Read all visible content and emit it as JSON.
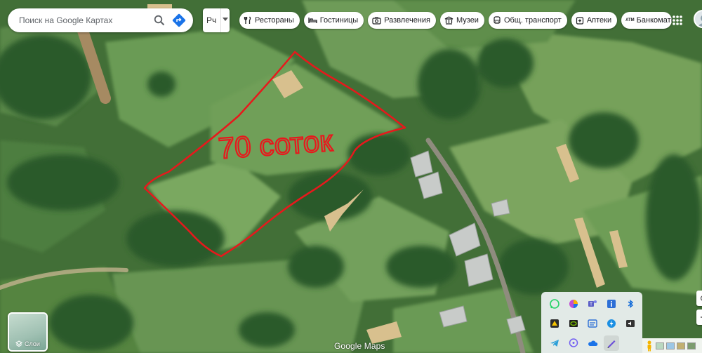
{
  "search": {
    "placeholder": "Поиск на Google Картах",
    "search_icon": "search-icon",
    "directions_icon": "directions-icon"
  },
  "language": {
    "label": "Рч"
  },
  "chips": [
    {
      "label": "Рестораны",
      "icon": "fork-knife-icon"
    },
    {
      "label": "Гостиницы",
      "icon": "bed-icon"
    },
    {
      "label": "Развлечения",
      "icon": "camera-icon"
    },
    {
      "label": "Музеи",
      "icon": "museum-icon"
    },
    {
      "label": "Общ. транспорт",
      "icon": "bus-icon"
    },
    {
      "label": "Аптеки",
      "icon": "pharmacy-icon"
    },
    {
      "label": "Банкоматы",
      "icon": "atm-icon"
    }
  ],
  "atm_badge": "ATM",
  "annotation": {
    "text": "70 соток",
    "color": "#e8181c"
  },
  "layers": {
    "label": "Слои"
  },
  "logo": "Google Maps",
  "tray_icons": [
    "whatsapp-icon",
    "color-picker-icon",
    "teams-icon",
    "info-app-icon",
    "bluetooth-icon",
    "warning-app-icon",
    "nvidia-icon",
    "steelseries-icon",
    "speedtest-icon",
    "audio-icon",
    "telegram-icon",
    "viber-icon",
    "onedrive-icon",
    "pen-icon"
  ],
  "colors": {
    "whatsapp": "#25d366",
    "teams": "#5b5fc7",
    "bluetooth": "#0a66d8",
    "telegram": "#2a9fd8",
    "viber": "#7360f2",
    "nvidia": "#76b900"
  }
}
